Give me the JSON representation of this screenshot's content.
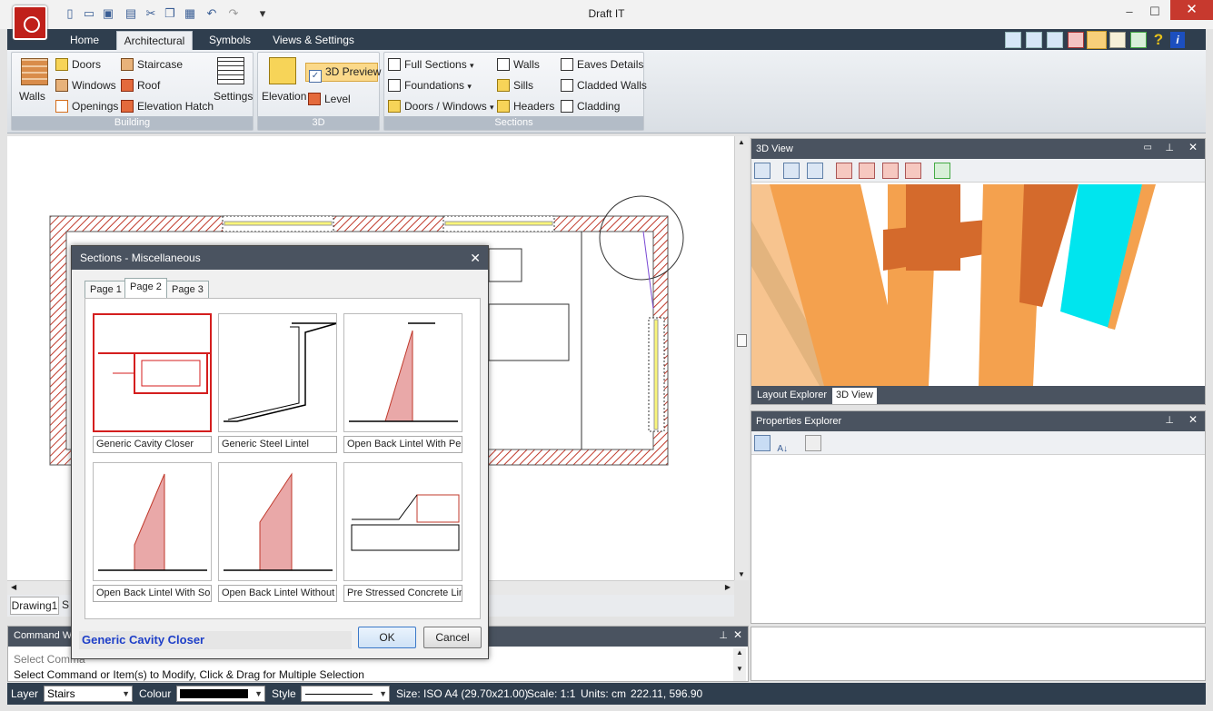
{
  "app": {
    "title": "Draft IT"
  },
  "quick_access": [
    "new-icon",
    "open-icon",
    "save-icon",
    "print-icon",
    "cut-icon",
    "copy-icon",
    "paste-icon",
    "undo-icon",
    "redo-icon",
    "customize-icon"
  ],
  "window": {
    "minimize": "–",
    "maximize": "☐",
    "close": "✕"
  },
  "tabs": [
    {
      "label": "Home"
    },
    {
      "label": "Architectural"
    },
    {
      "label": "Symbols"
    },
    {
      "label": "Views & Settings"
    }
  ],
  "ribbon": {
    "building": {
      "label": "Building",
      "walls": "Walls",
      "items": [
        "Doors",
        "Windows",
        "Openings",
        "Staircase",
        "Roof",
        "Elevation Hatch"
      ],
      "settings": "Settings"
    },
    "three_d": {
      "label": "3D",
      "elevation": "Elevation",
      "preview": "3D Preview",
      "level": "Level"
    },
    "sections": {
      "label": "Sections",
      "items": [
        "Full Sections",
        "Foundations",
        "Doors / Windows",
        "Walls",
        "Sills",
        "Headers",
        "Eaves Details",
        "Cladded Walls",
        "Cladding"
      ]
    }
  },
  "drawing_tabs": [
    "Drawing1",
    "S"
  ],
  "command_window": {
    "title": "Command Wi",
    "line1": "Select Comma",
    "line2": "Select Command or Item(s) to Modify, Click & Drag for Multiple Selection"
  },
  "view3d": {
    "title": "3D View",
    "tabs": [
      "Layout Explorer",
      "3D View"
    ]
  },
  "properties": {
    "title": "Properties Explorer"
  },
  "dialog": {
    "title": "Sections - Miscellaneous",
    "tabs": [
      "Page 1",
      "Page 2",
      "Page 3"
    ],
    "items": [
      "Generic Cavity Closer",
      "Generic Steel Lintel",
      "Open Back Lintel With Perf",
      "Open Back Lintel With Soli",
      "Open Back Lintel Without E",
      "Pre Stressed Concrete Lin"
    ],
    "selected": "Generic Cavity Closer",
    "ok": "OK",
    "cancel": "Cancel"
  },
  "status": {
    "layer_label": "Layer",
    "layer_value": "Stairs",
    "colour_label": "Colour",
    "style_label": "Style",
    "size": "Size: ISO A4 (29.70x21.00)",
    "scale": "Scale: 1:1",
    "units": "Units: cm",
    "coords": "222.11, 596.90"
  },
  "colors": {
    "accent": "#2f3e4e",
    "hatch": "#c0392b",
    "selection": "#d41e1e",
    "cyan": "#00e5ee",
    "wood": "#f4a14e"
  }
}
